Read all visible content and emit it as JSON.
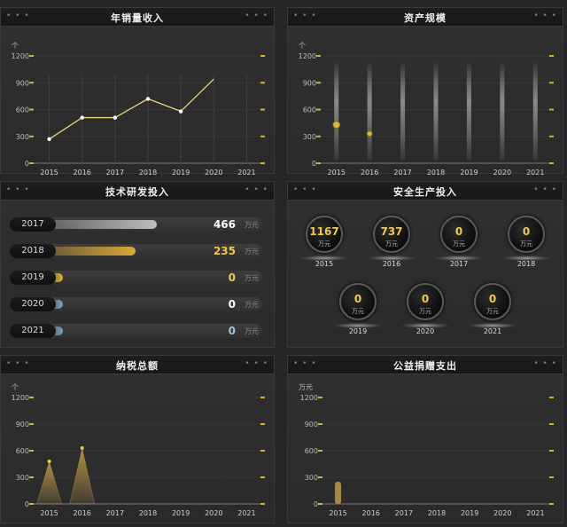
{
  "panels": {
    "sales": {
      "title": "年销量收入"
    },
    "assets": {
      "title": "资产规模"
    },
    "rd": {
      "title": "技术研发投入"
    },
    "safety": {
      "title": "安全生产投入"
    },
    "tax": {
      "title": "纳税总额"
    },
    "charity": {
      "title": "公益捐赠支出"
    }
  },
  "dots": "• • •",
  "chart_data": [
    {
      "id": "sales",
      "type": "line",
      "title": "年销量收入",
      "unit": "个",
      "categories": [
        "2015",
        "2016",
        "2017",
        "2018",
        "2019",
        "2020",
        "2021"
      ],
      "yticks": [
        0,
        300,
        600,
        900,
        1200
      ],
      "ylim": [
        0,
        1200
      ],
      "series": [
        {
          "values": [
            270,
            510,
            510,
            720,
            580,
            940,
            null
          ]
        }
      ],
      "colors": {
        "line": "#e8d27a"
      }
    },
    {
      "id": "assets",
      "type": "scatter",
      "title": "资产规模",
      "unit": "个",
      "categories": [
        "2015",
        "2016",
        "2017",
        "2018",
        "2019",
        "2020",
        "2021"
      ],
      "yticks": [
        0,
        300,
        600,
        900,
        1200
      ],
      "ylim": [
        0,
        1200
      ],
      "series": [
        {
          "values": [
            430,
            330,
            null,
            null,
            null,
            null,
            null
          ]
        }
      ],
      "colors": {
        "point": "#e0b83a"
      }
    },
    {
      "id": "rd",
      "type": "bar",
      "title": "技术研发投入",
      "unit": "万元",
      "categories": [
        "2017",
        "2018",
        "2019",
        "2020",
        "2021"
      ],
      "values": [
        466,
        235,
        0,
        0,
        0
      ],
      "fill_fraction": [
        0.5,
        0.4,
        0.06,
        0.06,
        0.06
      ],
      "colors": {
        "2017": "#bdbdbd",
        "2018": "#d8a93a",
        "2019": "#e0b83a",
        "2020": "#7fa3bf",
        "2021": "#7fa3bf"
      },
      "value_colors": [
        "#ffffff",
        "#f2c94c",
        "#f2c94c",
        "#ffffff",
        "#9fc3d6"
      ]
    },
    {
      "id": "safety",
      "type": "table",
      "title": "安全生产投入",
      "unit": "万元",
      "categories": [
        "2015",
        "2016",
        "2017",
        "2018",
        "2019",
        "2020",
        "2021"
      ],
      "values": [
        1167,
        737,
        0,
        0,
        0,
        0,
        0
      ]
    },
    {
      "id": "tax",
      "type": "area",
      "title": "纳税总额",
      "unit": "个",
      "categories": [
        "2015",
        "2016",
        "2017",
        "2018",
        "2019",
        "2020",
        "2021"
      ],
      "yticks": [
        0,
        300,
        600,
        900,
        1200
      ],
      "ylim": [
        0,
        1200
      ],
      "series": [
        {
          "values": [
            480,
            630,
            0,
            0,
            0,
            0,
            0
          ]
        }
      ],
      "colors": {
        "fill": "#c9a24a"
      }
    },
    {
      "id": "charity",
      "type": "bar",
      "title": "公益捐赠支出",
      "unit": "万元",
      "categories": [
        "2015",
        "2016",
        "2017",
        "2018",
        "2019",
        "2020",
        "2021"
      ],
      "yticks": [
        0,
        300,
        600,
        900,
        1200
      ],
      "ylim": [
        0,
        1200
      ],
      "series": [
        {
          "values": [
            250,
            0,
            0,
            0,
            0,
            0,
            0
          ]
        }
      ],
      "colors": {
        "bar": "#a8864a"
      }
    }
  ]
}
